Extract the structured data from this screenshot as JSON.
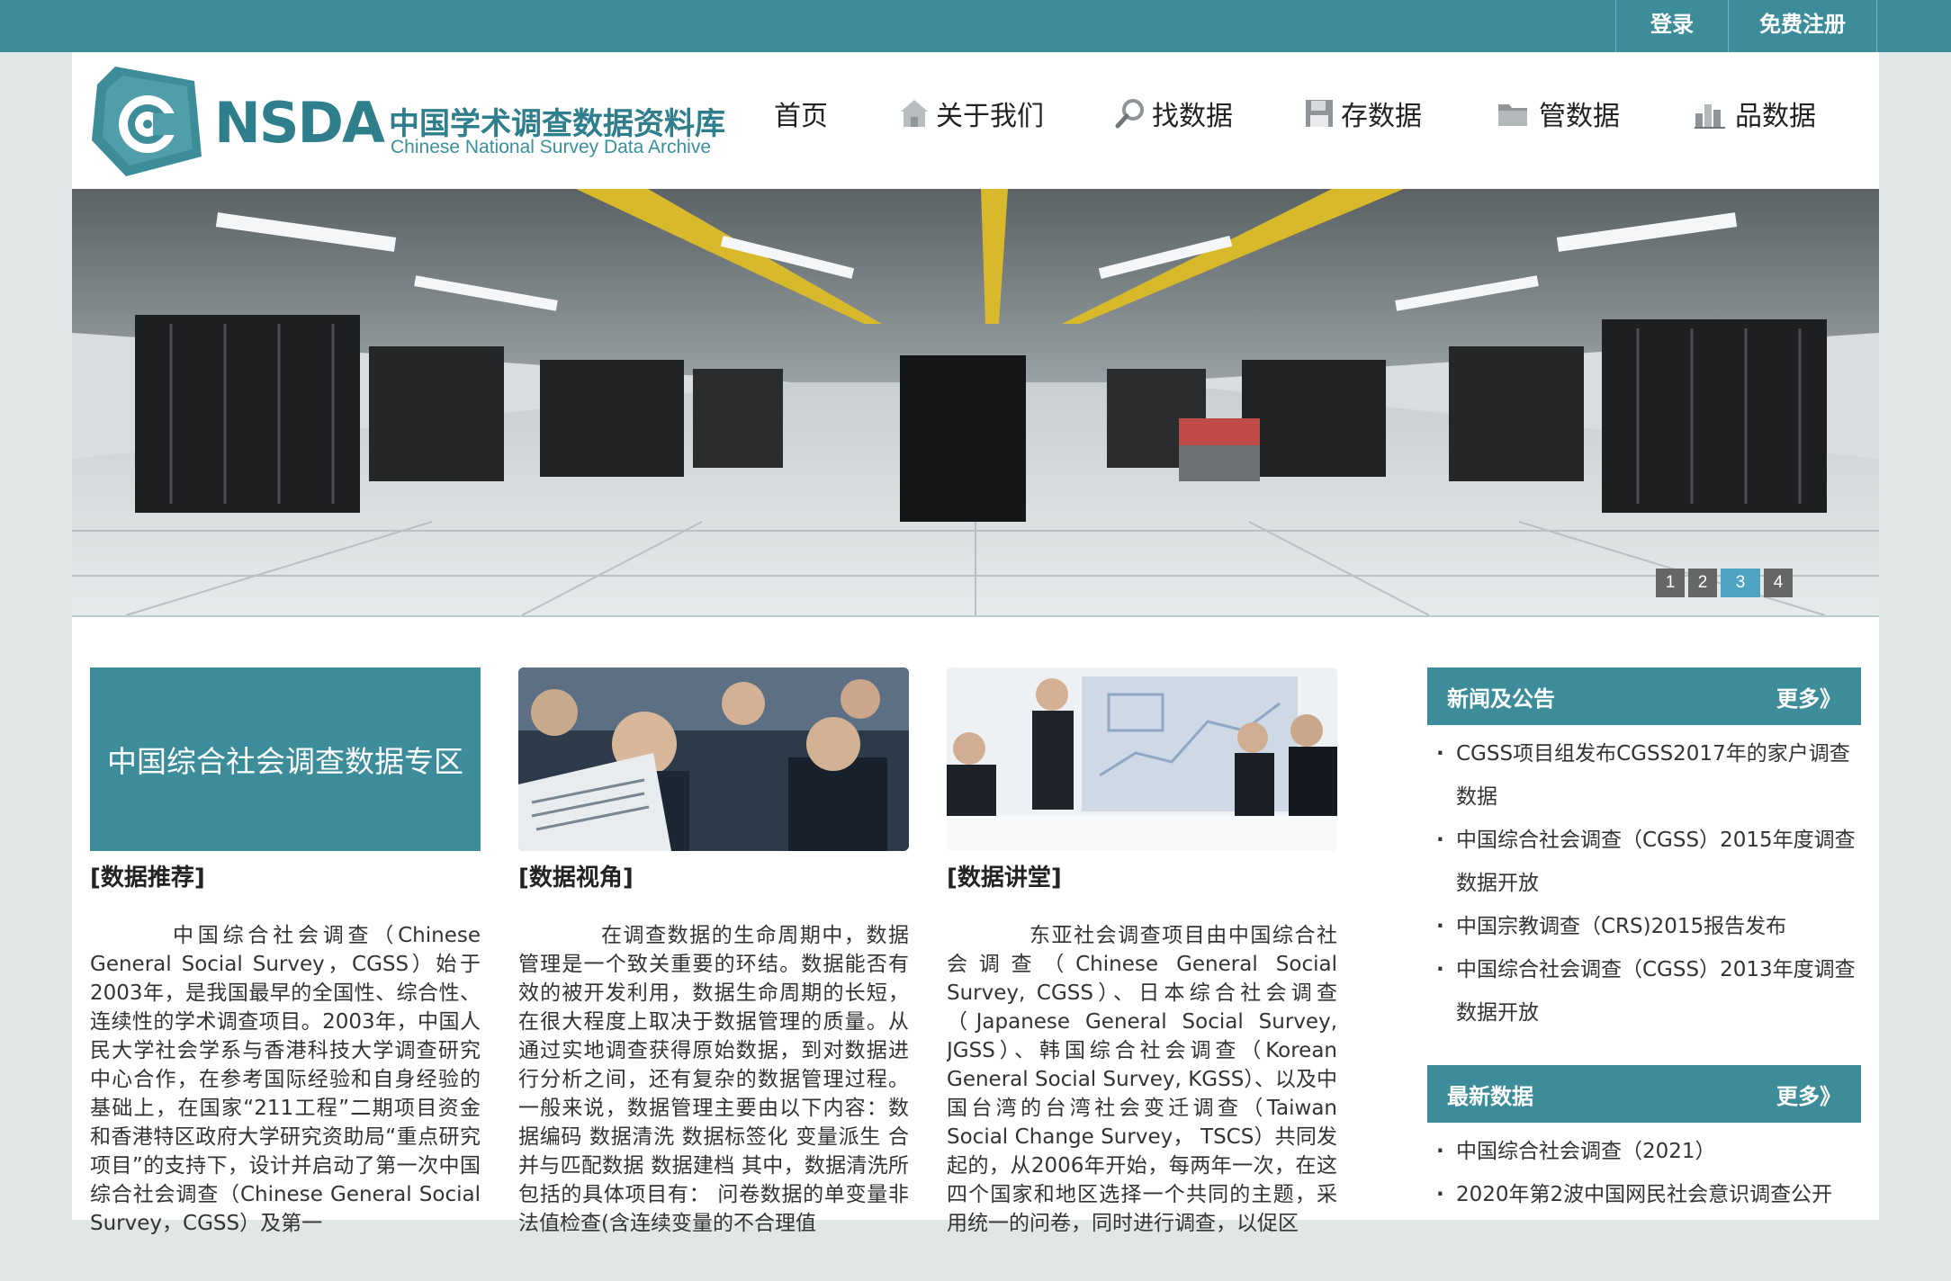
{
  "top": {
    "login": "登录",
    "register": "免费注册"
  },
  "logo": {
    "letters": "NSDA",
    "cn": "中国学术调查数据资料库",
    "en": "Chinese National Survey Data Archive"
  },
  "nav": [
    {
      "label": "首页",
      "icon": "none"
    },
    {
      "label": "关于我们",
      "icon": "house-icon"
    },
    {
      "label": "找数据",
      "icon": "magnifier-icon"
    },
    {
      "label": "存数据",
      "icon": "floppy-disk-icon"
    },
    {
      "label": "管数据",
      "icon": "folder-icon"
    },
    {
      "label": "品数据",
      "icon": "bar-chart-icon"
    }
  ],
  "banner": {
    "pages": [
      "1",
      "2",
      "3",
      "4"
    ],
    "active_page": 3
  },
  "columns": [
    {
      "box_title": "中国综合社会调查数据专区",
      "heading": "[数据推荐]",
      "text": "中国综合社会调查（Chinese General Social Survey，CGSS）始于2003年，是我国最早的全国性、综合性、连续性的学术调查项目。2003年，中国人民大学社会学系与香港科技大学调查研究中心合作，在参考国际经验和自身经验的基础上，在国家“211工程”二期项目资金和香港特区政府大学研究资助局“重点研究项目”的支持下，设计并启动了第一次中国综合社会调查（Chinese General Social Survey，CGSS）及第一"
    },
    {
      "heading": "[数据视角]",
      "text": "在调查数据的生命周期中，数据管理是一个致关重要的环结。数据能否有效的被开发利用，数据生命周期的长短，在很大程度上取决于数据管理的质量。从通过实地调查获得原始数据，到对数据进行分析之间，还有复杂的数据管理过程。一般来说，数据管理主要由以下内容：数据编码 数据清洗 数据标签化 变量派生 合并与匹配数据 数据建档 其中，数据清洗所包括的具体项目有： 问卷数据的单变量非法值检查(含连续变量的不合理值"
    },
    {
      "heading": "[数据讲堂]",
      "text": "东亚社会调查项目由中国综合社会调查（Chinese General Social Survey, CGSS）、日本综合社会调查（Japanese General Social Survey, JGSS）、韩国综合社会调查（Korean General Social Survey, KGSS）、以及中国台湾的台湾社会变迁调查（Taiwan Social Change Survey， TSCS）共同发起的，从2006年开始，每两年一次，在这四个国家和地区选择一个共同的主题，采用统一的问卷，同时进行调查，以促区"
    }
  ],
  "news": {
    "title": "新闻及公告",
    "more": "更多》",
    "items": [
      "CGSS项目组发布CGSS2017年的家户调查数据",
      "中国综合社会调查（CGSS）2015年度调查数据开放",
      "中国宗教调查（CRS)2015报告发布",
      "中国综合社会调查（CGSS）2013年度调查数据开放"
    ]
  },
  "latest": {
    "title": "最新数据",
    "more": "更多》",
    "items": [
      "中国综合社会调查（2021）",
      "2020年第2波中国网民社会意识调查公开"
    ]
  },
  "colors": {
    "accent": "#3c8c9a",
    "background": "#e1e6e7"
  }
}
